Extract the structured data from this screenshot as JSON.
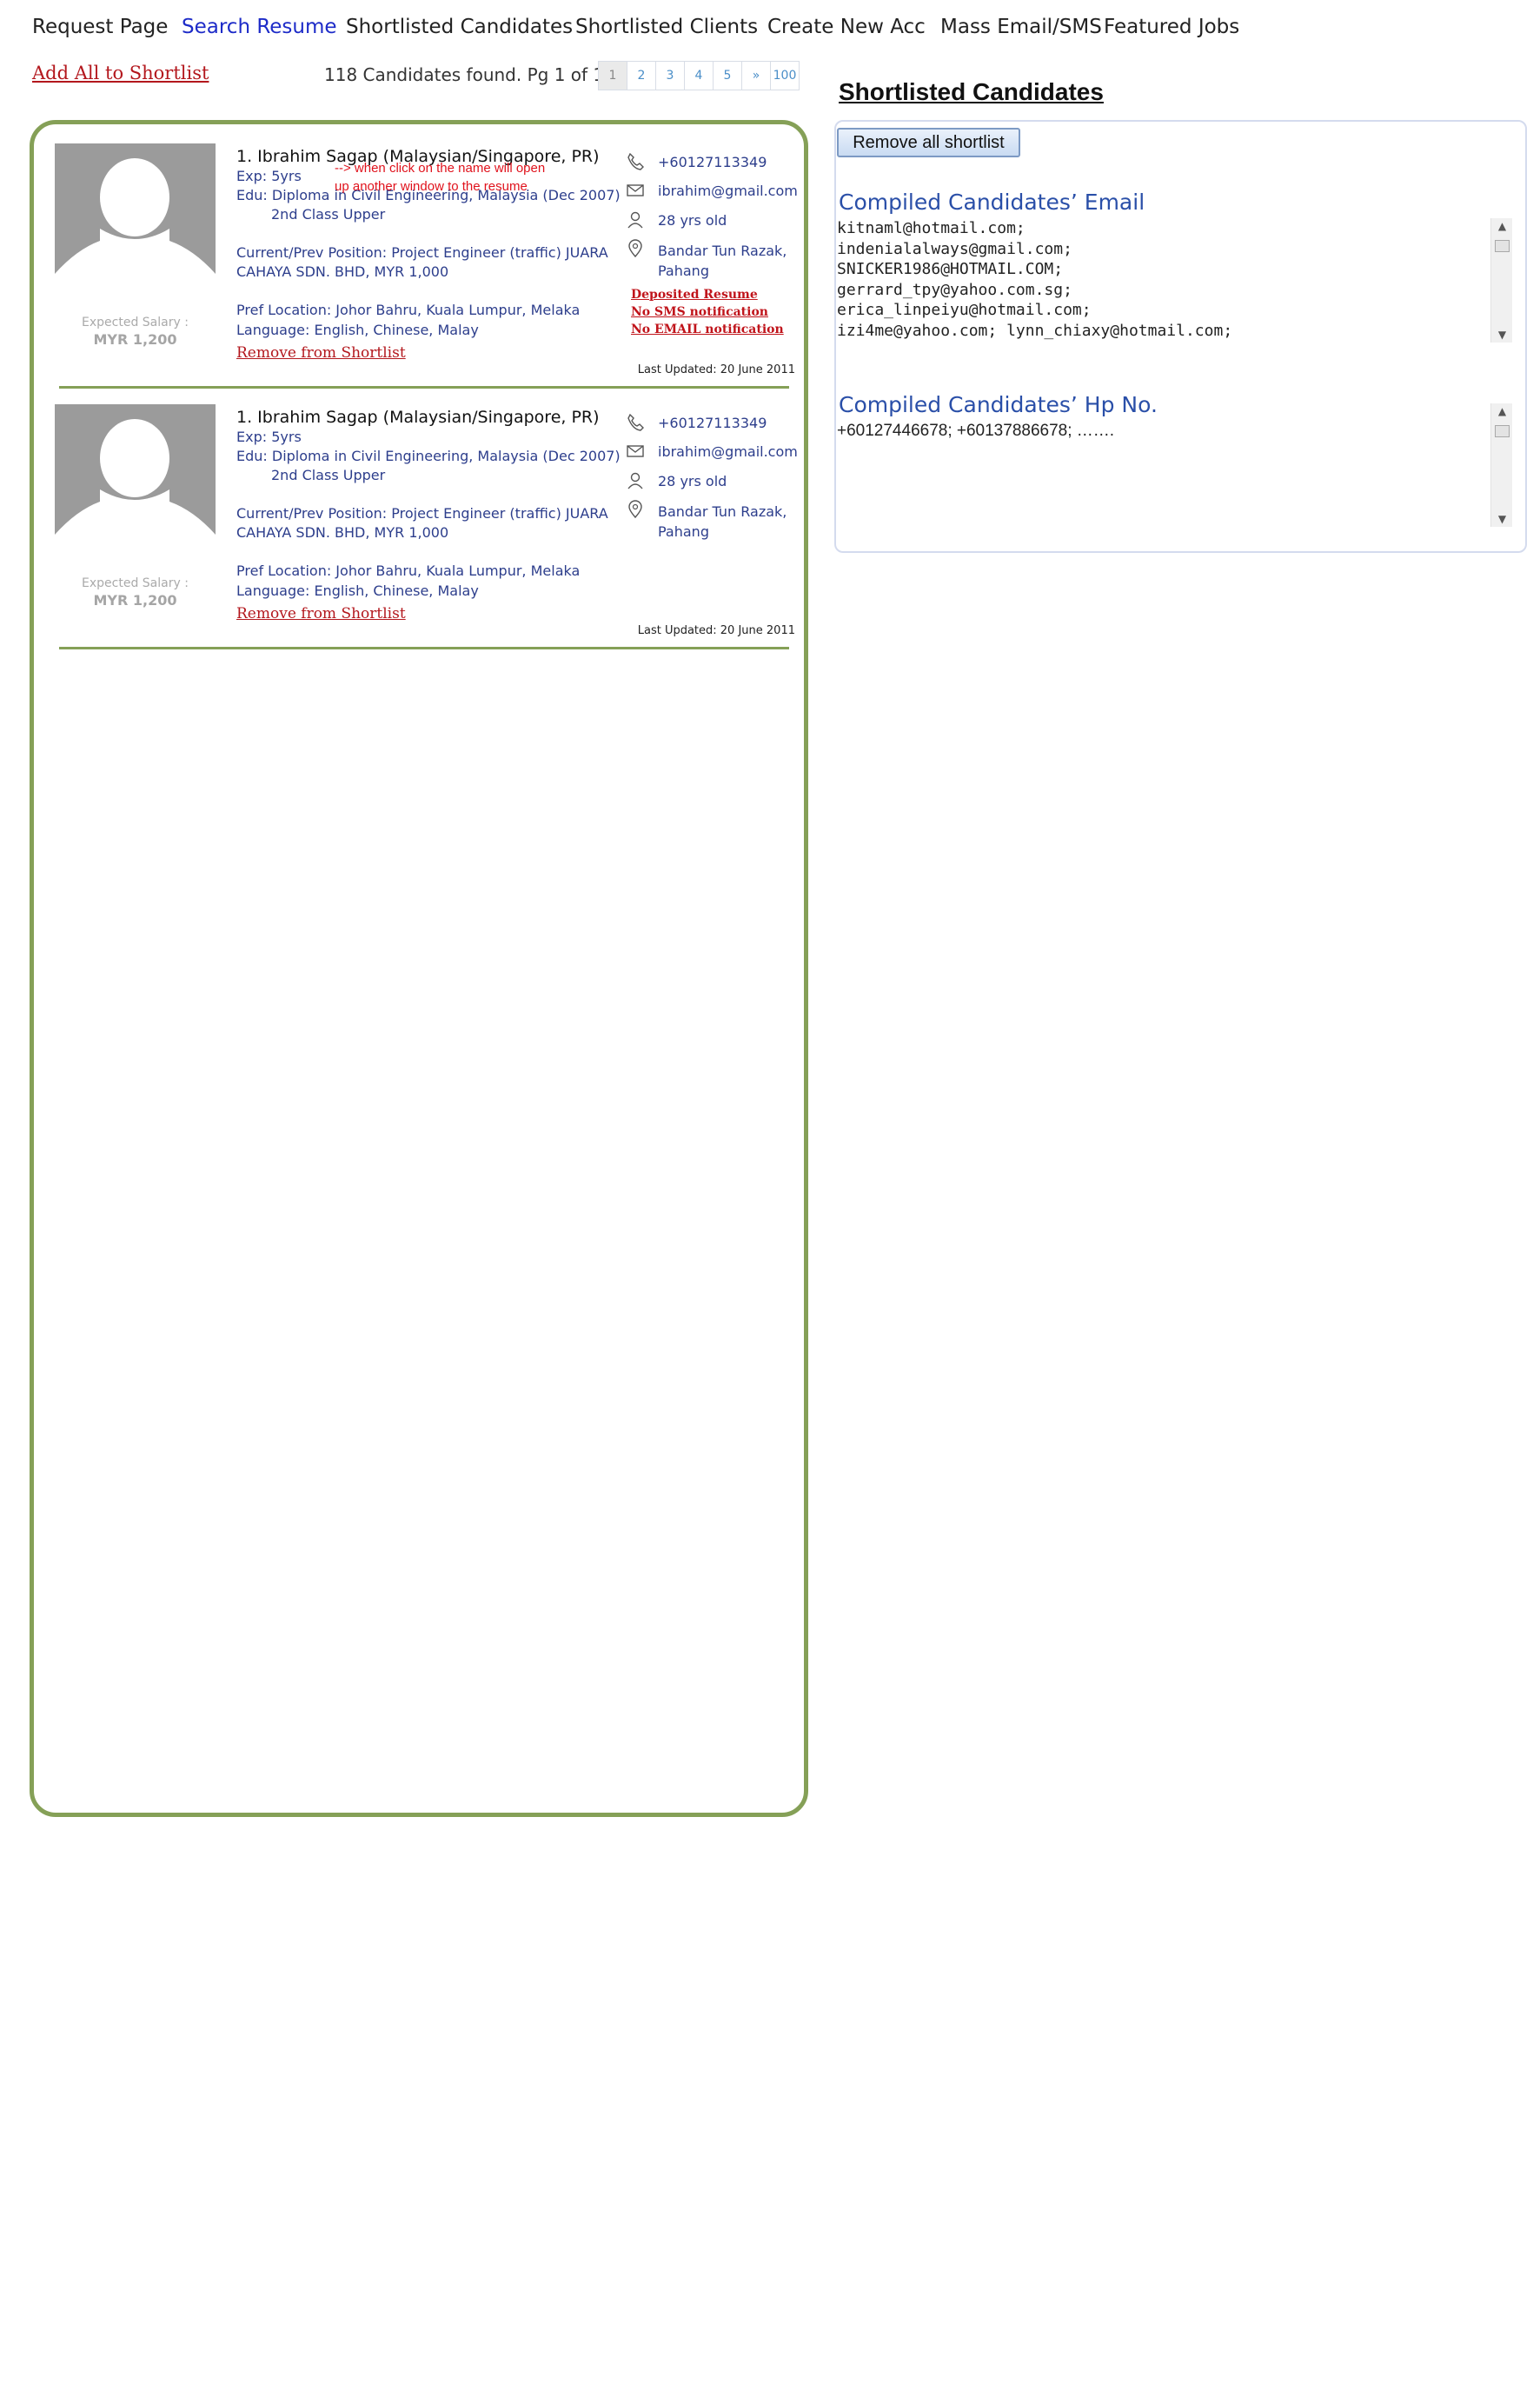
{
  "nav": {
    "items": [
      {
        "label": "Request Page"
      },
      {
        "label": "Search Resume"
      },
      {
        "label": "Shortlisted Candidates"
      },
      {
        "label": "Shortlisted Clients"
      },
      {
        "label": "Create New Acc"
      },
      {
        "label": "Mass Email/SMS"
      },
      {
        "label": "Featured Jobs"
      }
    ],
    "active": "Search Resume"
  },
  "toolbar": {
    "add_all_label": "Add All to Shortlist",
    "found_text": "118 Candidates found. Pg 1 of 100",
    "pages": [
      "1",
      "2",
      "3",
      "4",
      "5",
      "»",
      "100"
    ],
    "current_page": "1"
  },
  "candidates": [
    {
      "name": "1. Ibrahim Sagap (Malaysian/Singapore, PR)",
      "name_note": "--> when click on the name will open up another window to the resume",
      "exp": "Exp: 5yrs",
      "edu": "Edu: Diploma in Civil Engineering, Malaysia (Dec 2007)",
      "edu_class": "2nd Class Upper",
      "position_line1": "Current/Prev Position: Project Engineer (traffic) JUARA",
      "position_line2": "CAHAYA SDN. BHD, MYR 1,000",
      "pref_location": "Pref Location: Johor Bahru, Kuala Lumpur, Melaka",
      "language": "Language: English, Chinese, Malay",
      "remove_label": "Remove from Shortlist",
      "salary_label": "Expected Salary :",
      "salary_value": "MYR 1,200",
      "phone": "+60127113349",
      "email": "ibrahim@gmail.com",
      "age": "28 yrs old",
      "location_line1": "Bandar Tun Razak,",
      "location_line2": "Pahang",
      "flags": [
        "Deposited Resume",
        "No SMS notification",
        "No EMAIL notification"
      ],
      "updated": "Last Updated: 20 June 2011"
    },
    {
      "name": "1. Ibrahim Sagap (Malaysian/Singapore, PR)",
      "exp": "Exp: 5yrs",
      "edu": "Edu: Diploma in Civil Engineering, Malaysia (Dec 2007)",
      "edu_class": "2nd Class Upper",
      "position_line1": "Current/Prev Position: Project Engineer (traffic) JUARA",
      "position_line2": "CAHAYA SDN. BHD, MYR 1,000",
      "pref_location": "Pref Location: Johor Bahru, Kuala Lumpur, Melaka",
      "language": "Language: English, Chinese, Malay",
      "remove_label": "Remove from Shortlist",
      "salary_label": "Expected Salary :",
      "salary_value": "MYR 1,200",
      "phone": "+60127113349",
      "email": "ibrahim@gmail.com",
      "age": "28 yrs old",
      "location_line1": "Bandar Tun Razak,",
      "location_line2": "Pahang",
      "updated": "Last Updated: 20 June 2011"
    }
  ],
  "right": {
    "title": "Shortlisted Candidates",
    "remove_all_label": "Remove all shortlist",
    "email_heading": "Compiled Candidates’ Email",
    "emails": "kitnaml@hotmail.com;\nindenialalways@gmail.com;\nSNICKER1986@HOTMAIL.COM;\ngerrard_tpy@yahoo.com.sg;\nerica_linpeiyu@hotmail.com;\nizi4me@yahoo.com; lynn_chiaxy@hotmail.com;",
    "hp_heading": "Compiled Candidates’ Hp No.",
    "hp_numbers": "+60127446678; +60137886678; ……."
  },
  "colors": {
    "panel_border": "#85a057",
    "link_red": "#b3171d",
    "text_blue": "#2d3e8c",
    "heading_blue": "#2a4fa8",
    "active_nav": "#1d2bc8"
  },
  "icons": [
    "phone-icon",
    "email-icon",
    "person-icon",
    "location-pin-icon",
    "avatar-silhouette-icon"
  ]
}
